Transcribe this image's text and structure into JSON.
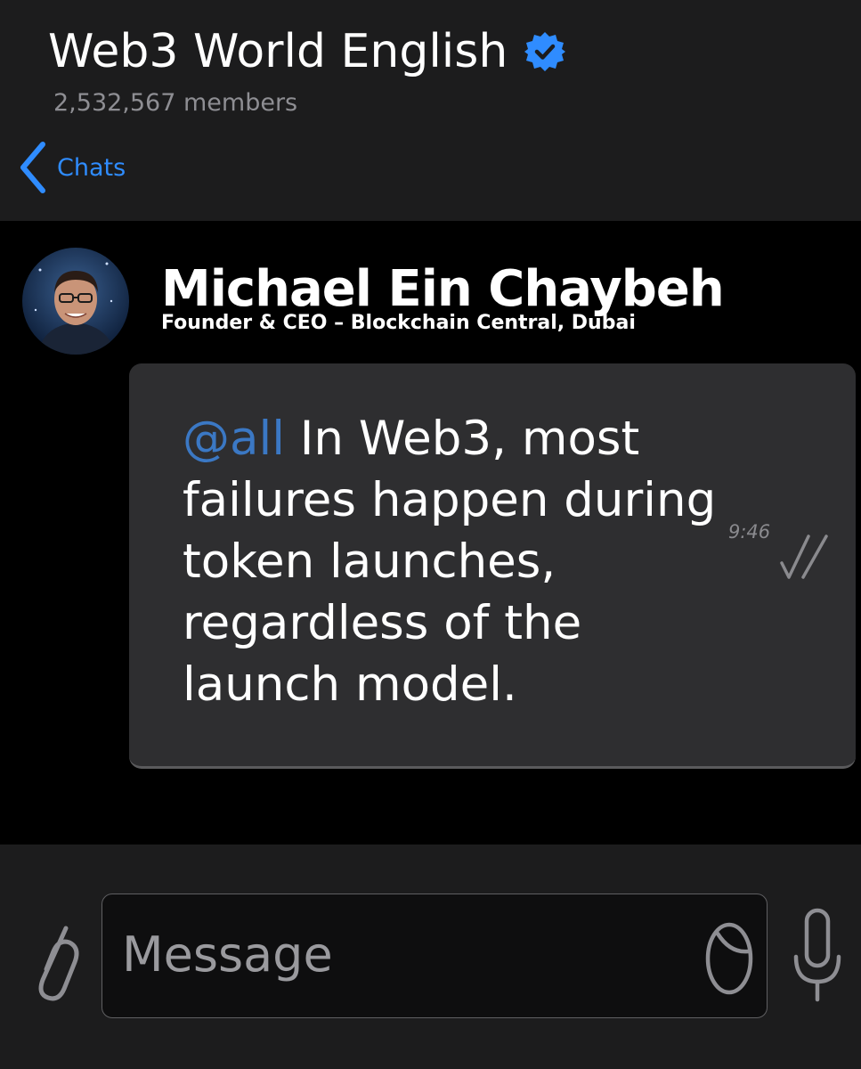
{
  "header": {
    "title": "Web3 World English",
    "members": "2,532,567 members",
    "back_label": "Chats"
  },
  "message": {
    "sender_name": "Michael Ein Chaybeh",
    "sender_role": "Founder & CEO – Blockchain Central, Dubai",
    "mention": "@all",
    "text": " In Web3, most failures happen during token launches, regardless of the launch model.",
    "time": "9:46"
  },
  "composer": {
    "placeholder": "Message"
  },
  "colors": {
    "accent": "#2f8cff",
    "mention": "#3b78c4",
    "bubble": "#2e2e30",
    "header_bg": "#1c1c1d"
  },
  "icons": {
    "verified": "verified-badge-icon",
    "back": "chevron-left-icon",
    "attach": "paperclip-icon",
    "sticker": "sticker-icon",
    "mic": "microphone-icon",
    "read": "double-check-icon"
  }
}
